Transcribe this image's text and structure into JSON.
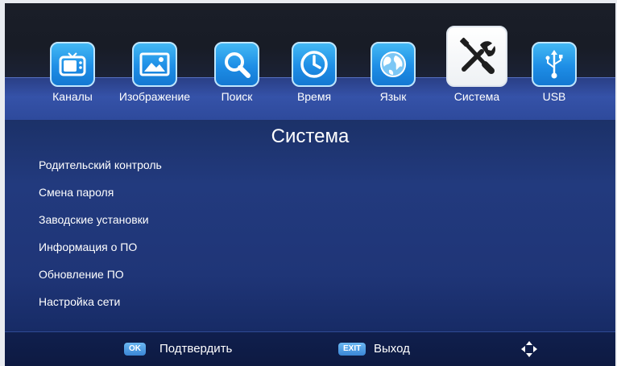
{
  "menu": {
    "tabs": [
      {
        "label": "Каналы",
        "icon": "tv-icon"
      },
      {
        "label": "Изображение",
        "icon": "picture-icon"
      },
      {
        "label": "Поиск",
        "icon": "search-icon"
      },
      {
        "label": "Время",
        "icon": "clock-icon"
      },
      {
        "label": "Язык",
        "icon": "globe-icon"
      },
      {
        "label": "Система",
        "icon": "tools-icon"
      },
      {
        "label": "USB",
        "icon": "usb-icon"
      }
    ],
    "active_index": 5
  },
  "page": {
    "title": "Система"
  },
  "list": {
    "items": [
      "Родительский контроль",
      "Смена пароля",
      "Заводские установки",
      "Информация о ПО",
      "Обновление ПО",
      "Настройка сети"
    ]
  },
  "footer": {
    "ok_key": "OK",
    "ok_label": "Подтвердить",
    "exit_key": "EXIT",
    "exit_label": "Выход",
    "nav_icon": "dpad-arrows-icon"
  },
  "colors": {
    "background": "#223a7e",
    "icon_blue": "#1e8ee6",
    "text": "#ffffff"
  }
}
